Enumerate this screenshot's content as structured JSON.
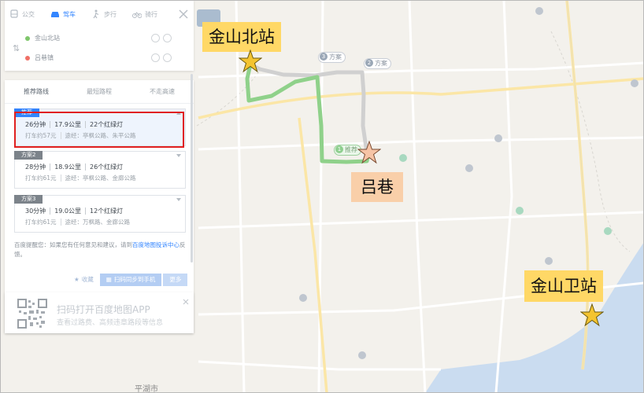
{
  "transport_modes": [
    {
      "label": "公交",
      "icon": "bus-icon",
      "active": false
    },
    {
      "label": "驾车",
      "icon": "car-icon",
      "active": true
    },
    {
      "label": "步行",
      "icon": "walk-icon",
      "active": false
    },
    {
      "label": "骑行",
      "icon": "bike-icon",
      "active": false
    }
  ],
  "stops": {
    "start": "金山北站",
    "end": "吕巷镇"
  },
  "route_tabs": [
    "推荐路线",
    "最短路程",
    "不走高速"
  ],
  "plans": [
    {
      "tag": "推荐",
      "duration": "26分钟",
      "distance": "17.9公里",
      "lights": "22个红绿灯",
      "taxi": "打车约57元",
      "via": "途经：亭枫公路、朱平公路",
      "selected": true
    },
    {
      "tag": "方案2",
      "duration": "28分钟",
      "distance": "18.9公里",
      "lights": "26个红绿灯",
      "taxi": "打车约61元",
      "via": "途经：亭枫公路、金廊公路",
      "selected": false
    },
    {
      "tag": "方案3",
      "duration": "30分钟",
      "distance": "19.0公里",
      "lights": "12个红绿灯",
      "taxi": "打车约61元",
      "via": "途经：万枫路、金廊公路",
      "selected": false
    }
  ],
  "tip": {
    "text": "百度提醒您：如果您有任何意见和建议，请到",
    "link": "百度地图投诉中心",
    "tail": "反馈。"
  },
  "actions": {
    "favorite": "收藏",
    "send_phone": "扫码同步到手机",
    "more": "更多"
  },
  "app_promo": {
    "title": "扫码打开百度地图APP",
    "subtitle": "查看过路费、高频违章路段等信息"
  },
  "map": {
    "route_labels": [
      {
        "num": "3",
        "text": "方案"
      },
      {
        "num": "2",
        "text": "方案"
      },
      {
        "num": "1",
        "text": "推荐"
      }
    ],
    "bottom_label": "平湖市"
  },
  "annotations": [
    {
      "text": "金山北站",
      "style": "yellow"
    },
    {
      "text": "吕巷",
      "style": "peach"
    },
    {
      "text": "金山卫站",
      "style": "yellow"
    }
  ],
  "colors": {
    "accent": "#3385ff",
    "route_main": "#8fd18a",
    "route_alt": "#c8c8c8",
    "water": "#c8dcf2",
    "highlight": "#e02020"
  }
}
